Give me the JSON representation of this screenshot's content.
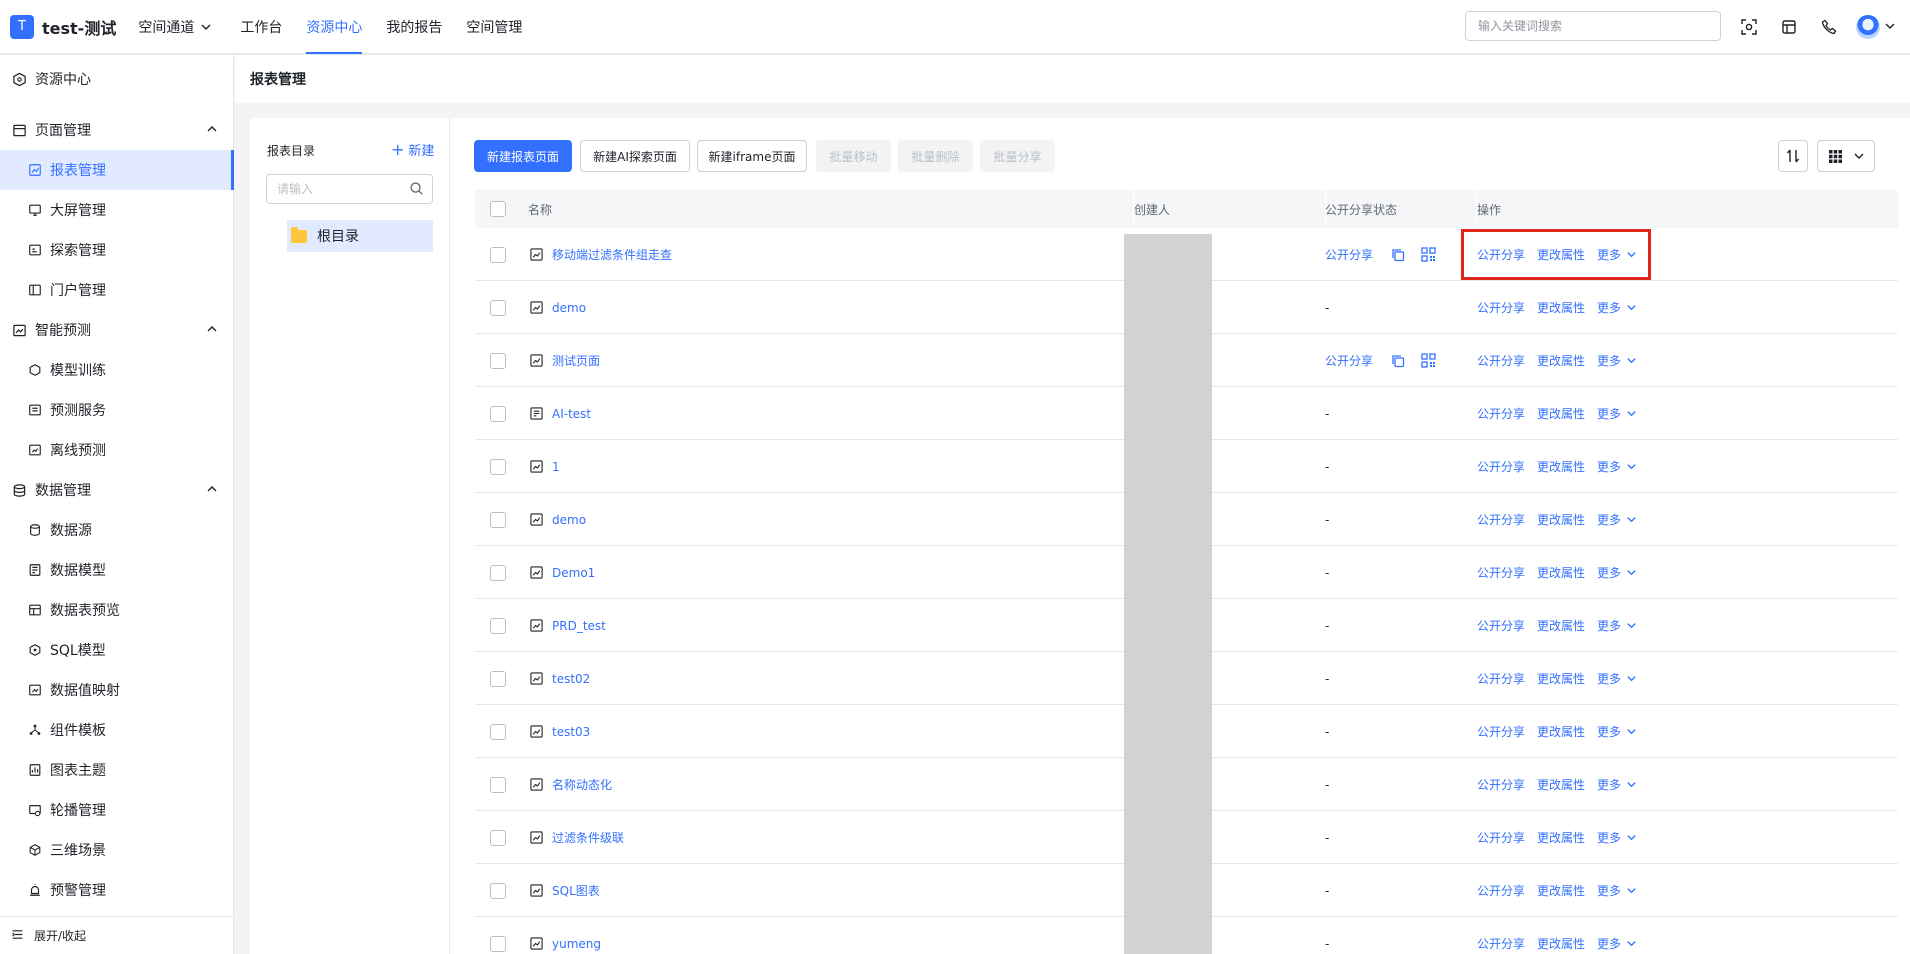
{
  "header": {
    "logo_letter": "T",
    "app_title": "test-测试",
    "space_switch": "空间通道",
    "nav": [
      "工作台",
      "资源中心",
      "我的报告",
      "空间管理"
    ],
    "active_nav": "资源中心",
    "search_placeholder": "输入关键词搜索",
    "icons": [
      "scan-icon",
      "calendar-icon",
      "phone-icon",
      "avatar"
    ]
  },
  "sidebar": {
    "root": "资源中心",
    "groups": [
      {
        "label": "页面管理",
        "items": [
          "报表管理",
          "大屏管理",
          "探索管理",
          "门户管理"
        ]
      },
      {
        "label": "智能预测",
        "items": [
          "模型训练",
          "预测服务",
          "离线预测"
        ]
      },
      {
        "label": "数据管理",
        "items": [
          "数据源",
          "数据模型",
          "数据表预览",
          "SQL模型",
          "数据值映射",
          "组件模板",
          "图表主题",
          "轮播管理",
          "三维场景",
          "预警管理"
        ]
      }
    ],
    "active_item": "报表管理",
    "footer": "展开/收起"
  },
  "page": {
    "title": "报表管理"
  },
  "directory": {
    "title": "报表目录",
    "new_label": "新建",
    "search_placeholder": "请输入",
    "root_node": "根目录"
  },
  "toolbar": {
    "new_report": "新建报表页面",
    "new_ai": "新建AI探索页面",
    "new_iframe": "新建iframe页面",
    "batch_move": "批量移动",
    "batch_delete": "批量删除",
    "batch_share": "批量分享"
  },
  "table": {
    "columns": [
      "名称",
      "创建人",
      "公开分享状态",
      "操作"
    ],
    "rows": [
      {
        "name": "移动端过滤条件组走查",
        "share_status": "公开分享",
        "shared": true
      },
      {
        "name": "demo",
        "share_status": "-",
        "shared": false
      },
      {
        "name": "测试页面",
        "share_status": "公开分享",
        "shared": true
      },
      {
        "name": "AI-test",
        "share_status": "-",
        "shared": false
      },
      {
        "name": "1",
        "share_status": "-",
        "shared": false
      },
      {
        "name": "demo",
        "share_status": "-",
        "shared": false
      },
      {
        "name": "Demo1",
        "share_status": "-",
        "shared": false
      },
      {
        "name": "PRD_test",
        "share_status": "-",
        "shared": false
      },
      {
        "name": "test02",
        "share_status": "-",
        "shared": false
      },
      {
        "name": "test03",
        "share_status": "-",
        "shared": false
      },
      {
        "name": "名称动态化",
        "share_status": "-",
        "shared": false
      },
      {
        "name": "过滤条件级联",
        "share_status": "-",
        "shared": false
      },
      {
        "name": "SQL图表",
        "share_status": "-",
        "shared": false
      },
      {
        "name": "yumeng",
        "share_status": "-",
        "shared": false
      }
    ],
    "actions": {
      "share": "公开分享",
      "edit": "更改属性",
      "more": "更多"
    }
  },
  "colors": {
    "accent": "#3370ff",
    "highlight": "#e0261b"
  }
}
